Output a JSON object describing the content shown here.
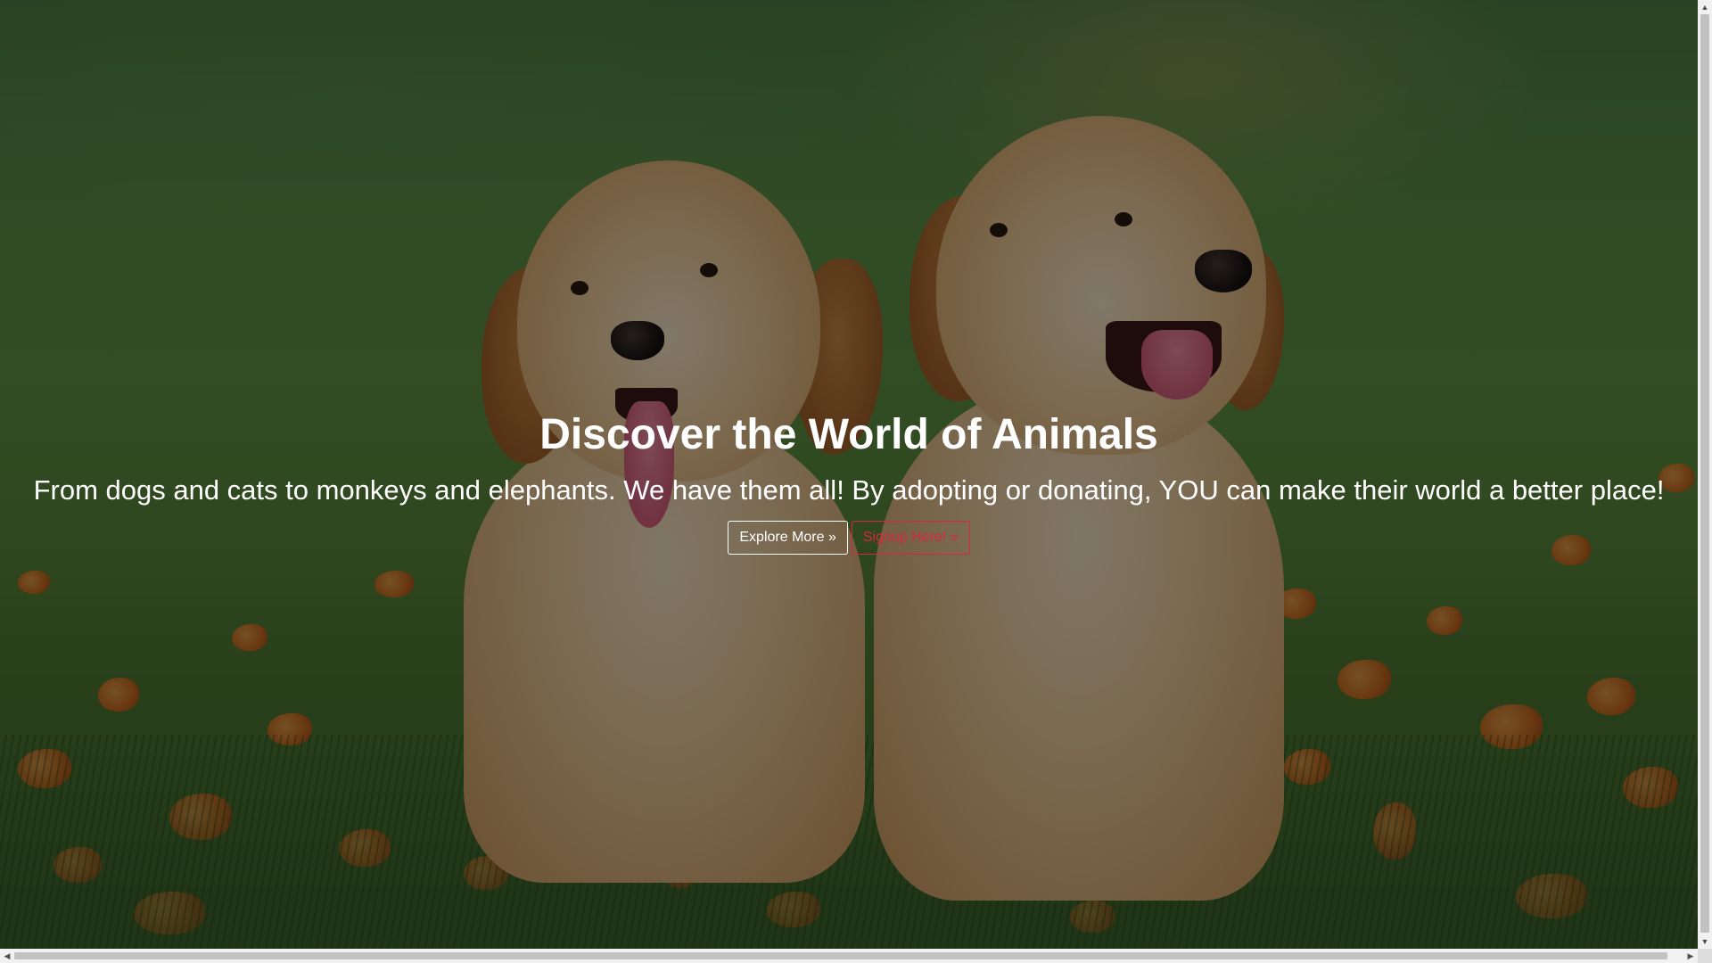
{
  "hero": {
    "title": "Discover the World of Animals",
    "subtitle": "From dogs and cats to monkeys and elephants. We have them all! By adopting or donating, YOU can make their world a better place!",
    "explore_label": "Explore More »",
    "signup_label": "Signup Here! »"
  },
  "background": {
    "image": "two-golden-retriever-puppies-on-grass",
    "overlay_color": "#000000"
  },
  "colors": {
    "text": "#ffffff",
    "signup_accent": "#d9283b"
  },
  "scrollbars": {
    "up_arrow": "▲",
    "down_arrow": "▼",
    "left_arrow": "◀",
    "right_arrow": "▶"
  }
}
